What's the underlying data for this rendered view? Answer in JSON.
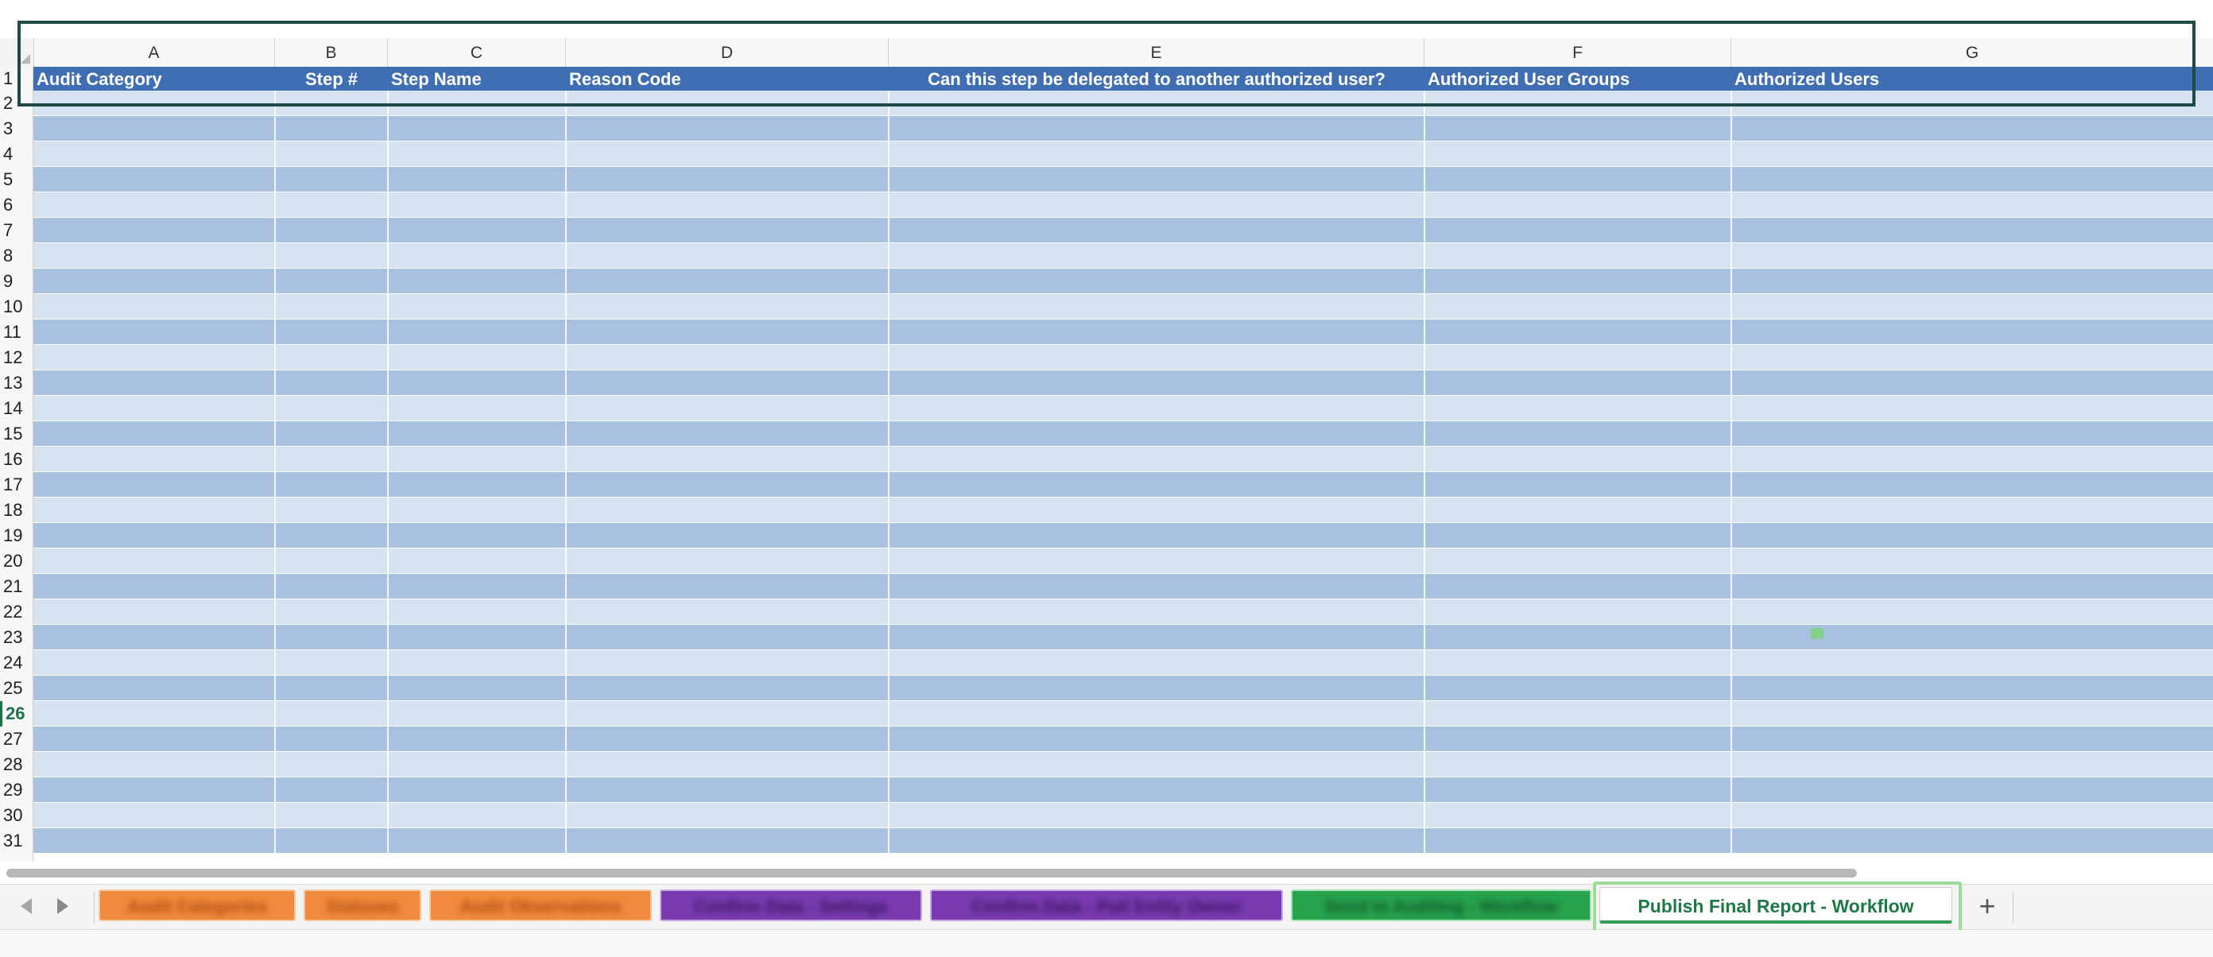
{
  "spreadsheet": {
    "columns": [
      "A",
      "B",
      "C",
      "D",
      "E",
      "F",
      "G"
    ],
    "header_row": [
      "Audit Category",
      "Step #",
      "Step Name",
      "Reason Code",
      "Can this step be delegated to another authorized user?",
      "Authorized User Groups",
      "Authorized Users"
    ],
    "row_numbers": [
      "1",
      "2",
      "3",
      "4",
      "5",
      "6",
      "7",
      "8",
      "9",
      "10",
      "11",
      "12",
      "13",
      "14",
      "15",
      "16",
      "17",
      "18",
      "19",
      "20",
      "21",
      "22",
      "23",
      "24",
      "25",
      "26",
      "27",
      "28",
      "29",
      "30",
      "31"
    ],
    "active_row": "26"
  },
  "sheet_tabs": {
    "tabs": [
      {
        "label": "Audit Categories",
        "color": "#f08a3c"
      },
      {
        "label": "Statuses",
        "color": "#f08a3c"
      },
      {
        "label": "Audit Observations",
        "color": "#f08a3c"
      },
      {
        "label": "Confirm Data - Settings",
        "color": "#7a3bb0"
      },
      {
        "label": "Confirm Data - Pull Entity Owner",
        "color": "#7a3bb0"
      },
      {
        "label": "Send to Auditing - Workflow",
        "color": "#27a24d"
      },
      {
        "label": "Publish Final Report - Workflow",
        "color": "#ffffff"
      }
    ],
    "active_tab": "Publish Final Report - Workflow",
    "add_sheet_label": "+",
    "prev_icon": "chevron-left-icon",
    "next_icon": "chevron-right-icon"
  },
  "colors": {
    "header_fill": "#3f6fb2",
    "band_light": "#d7e2f0",
    "band_dark": "#a8c1df",
    "selection_outline": "#1f4a46",
    "active_tab_text": "#1e7a44"
  }
}
